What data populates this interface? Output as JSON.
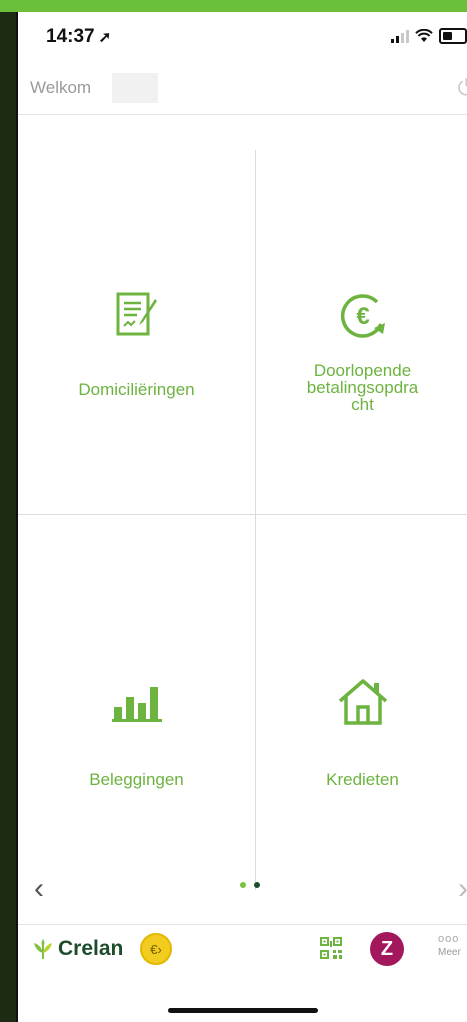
{
  "status_bar": {
    "time": "14:37",
    "location_glyph": "➚"
  },
  "header": {
    "welcome": "Welkom",
    "power_glyph": "⏻"
  },
  "tiles": [
    {
      "label": "Domiciliëringen",
      "icon": "document-signature-icon"
    },
    {
      "label_lines": [
        "Doorlopende",
        "betalingsopdra",
        "cht"
      ],
      "icon": "euro-recurring-icon"
    },
    {
      "label": "Beleggingen",
      "icon": "bar-chart-icon"
    },
    {
      "label": "Kredieten",
      "icon": "house-icon"
    }
  ],
  "pager": {
    "left": "‹",
    "right": "›",
    "pages": 2,
    "active_page": 1
  },
  "bottom_bar": {
    "logo_text": "Crelan",
    "euro_button": "€›",
    "z_button": "Z",
    "more_dots": "ooo",
    "more_label": "Meer"
  },
  "colors": {
    "accent_green": "#6cb33f",
    "dot_active": "#7cc142",
    "dot_inactive": "#1e4d2b",
    "z_purple": "#a3175d",
    "euro_yellow": "#f2cc1e"
  }
}
